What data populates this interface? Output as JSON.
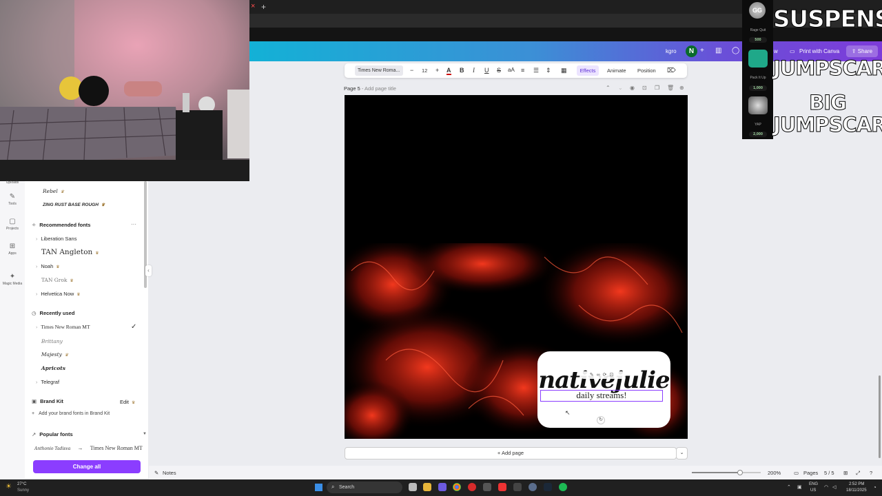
{
  "browser": {
    "tab_close": "×",
    "new_tab": "+"
  },
  "header": {
    "user_short": "kgro",
    "avatar_letter": "N",
    "add": "+",
    "partial_btn": "w",
    "print_label": "Print with Canva",
    "share_label": "Share"
  },
  "rail": [
    {
      "label": "Uploads",
      "icon": "upload-icon"
    },
    {
      "label": "Tools",
      "icon": "tools-icon"
    },
    {
      "label": "Projects",
      "icon": "folder-icon"
    },
    {
      "label": "Apps",
      "icon": "apps-icon"
    },
    {
      "label": "Magic Media",
      "icon": "magic-media-icon"
    }
  ],
  "font_panel": {
    "top_fonts": [
      "Rebel",
      "ZING RUST BASE ROUGH"
    ],
    "recommended_heading": "Recommended fonts",
    "recommended": [
      "Liberation Sans",
      "TAN Angleton",
      "Noah",
      "TAN Grok",
      "Helvetica Now"
    ],
    "recent_heading": "Recently used",
    "recent": [
      "Times New Roman MT",
      "Brittany",
      "Majesty",
      "Apricots",
      "Telegraf"
    ],
    "brand_heading": "Brand Kit",
    "brand_edit": "Edit",
    "brand_add": "Add your brand fonts in Brand Kit",
    "popular_heading": "Popular fonts",
    "swap_from": "Anthonio Tadisva",
    "swap_to": "Times New Roman MT",
    "change_all": "Change all"
  },
  "toolbar": {
    "font": "Times New Roma...",
    "minus": "−",
    "size": "12",
    "plus": "+",
    "effects": "Effects",
    "animate": "Animate",
    "position": "Position"
  },
  "page": {
    "label": "Page 5",
    "title_placeholder": "- Add page title",
    "logo_title": "nativejulie",
    "logo_sub": "daily streams!"
  },
  "add_page": "+ Add page",
  "footer": {
    "notes": "Notes",
    "zoom": "200%",
    "zoom_fraction": 0.7,
    "pages_label": "Pages",
    "page_count": "5 / 5"
  },
  "overlay": {
    "redeems": [
      {
        "name": "Rage Quit",
        "cost": "500",
        "color": "#6a6a6a"
      },
      {
        "name": "Pack It Up",
        "cost": "1,000",
        "color": "#1fa889"
      },
      {
        "name": "YAP",
        "cost": "2,000",
        "color": "#777777"
      }
    ],
    "lines": [
      "SUSPENSE",
      "JUMPSCARE",
      "BIG",
      "JUMPSCARE"
    ]
  },
  "taskbar": {
    "weather_temp": "27°C",
    "weather_desc": "Sunny",
    "search": "Search",
    "lang": "ENG",
    "region": "US",
    "time": "2:52 PM",
    "date": "18/11/2025"
  }
}
